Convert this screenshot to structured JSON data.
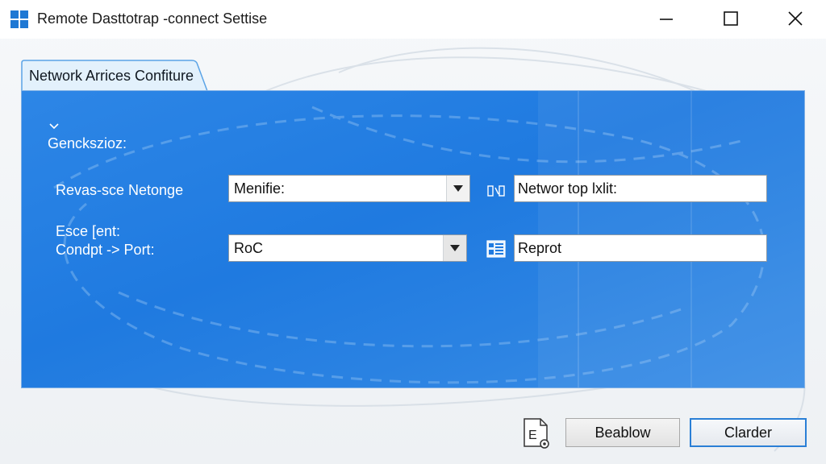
{
  "window": {
    "title": "Remote Dasttotrap -connect Settise",
    "icon": "windows-logo-icon",
    "controls": [
      "minimize-icon",
      "maximize-icon",
      "close-icon"
    ]
  },
  "tab": {
    "label": "Network Arrices Confiture"
  },
  "section": {
    "label": "Genckszioz:"
  },
  "rows": [
    {
      "label": "Revas-sce Netonge",
      "combo_value": "Menifie:",
      "field_icon": "network-icon",
      "field_value": "Networ top lxlit:"
    },
    {
      "label_line1": "Esce [ent:",
      "label_line2": "Condpt -> Port:",
      "combo_value": "RoC",
      "field_icon": "port-grid-icon",
      "field_value": "Reprot"
    }
  ],
  "footer": {
    "icon": "document-settings-icon",
    "button1_label": "Beablow",
    "button2_label": "Clarder"
  },
  "colors": {
    "panel_blue": "#1f7ae0",
    "focus_border": "#2a7fd6"
  }
}
